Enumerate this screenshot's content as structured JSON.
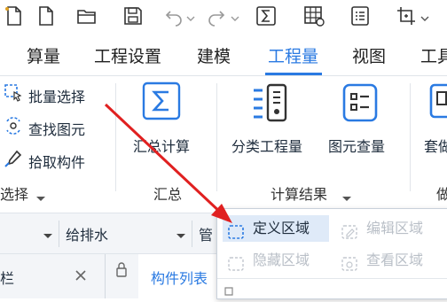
{
  "quick_access": {
    "icons": [
      "new-file-icon",
      "open-folder-icon",
      "save-icon",
      "undo-icon",
      "redo-icon",
      "summation-icon",
      "grid-icon",
      "report-icon",
      "crop-icon"
    ]
  },
  "tabs": [
    {
      "label": "算量",
      "active": false
    },
    {
      "label": "工程设置",
      "active": false
    },
    {
      "label": "建模",
      "active": false
    },
    {
      "label": "工程量",
      "active": true
    },
    {
      "label": "视图",
      "active": false
    },
    {
      "label": "工具",
      "active": false
    }
  ],
  "ribbon": {
    "select_group": {
      "items": [
        "批量选择",
        "查找图元",
        "拾取构件"
      ],
      "label": "选择"
    },
    "summary_group": {
      "button": "汇总计算",
      "label": "汇总"
    },
    "result_group": {
      "buttons": [
        "分类工程量",
        "图元查量"
      ],
      "label": "计算结果"
    },
    "partial": {
      "button": "套做",
      "label": "做"
    }
  },
  "filter_bar": {
    "selection": "给排水",
    "next": "管"
  },
  "panel_tabs": {
    "left": "栏",
    "list": "构件列表"
  },
  "dropdown_menu": {
    "items": [
      {
        "label": "定义区域",
        "enabled": true,
        "highlighted": true
      },
      {
        "label": "编辑区域",
        "enabled": false,
        "highlighted": false
      },
      {
        "label": "隐藏区域",
        "enabled": false,
        "highlighted": false
      },
      {
        "label": "查看区域",
        "enabled": false,
        "highlighted": false
      }
    ]
  },
  "colors": {
    "accent": "#2a7ae2",
    "arrow": "#e02020",
    "disabled": "#b9bfc7",
    "highlight": "#dfeaf8"
  }
}
